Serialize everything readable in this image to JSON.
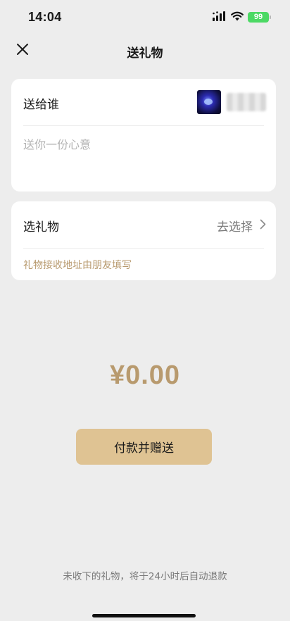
{
  "status_bar": {
    "time": "14:04",
    "battery_level": "99",
    "icons": [
      "signal-icon",
      "wifi-icon",
      "battery-icon"
    ],
    "battery_color": "#4cd964"
  },
  "nav": {
    "title": "送礼物",
    "close_icon": "close-icon"
  },
  "recipient_card": {
    "label": "送给谁",
    "message_placeholder": "送你一份心意",
    "message_value": ""
  },
  "gift_card": {
    "label": "选礼物",
    "select_text": "去选择",
    "note": "礼物接收地址由朋友填写"
  },
  "payment": {
    "amount": "¥0.00",
    "button_label": "付款并赠送"
  },
  "footer": {
    "note": "未收下的礼物，将于24小时后自动退款"
  },
  "colors": {
    "background": "#ededed",
    "accent_gold": "#b89a6e",
    "button_gold": "#dfc393"
  }
}
